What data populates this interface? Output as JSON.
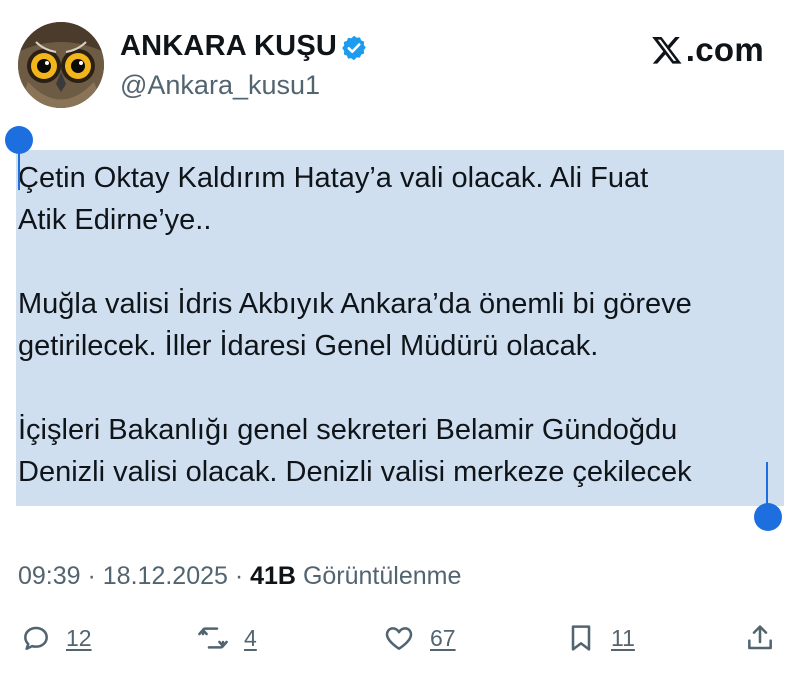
{
  "profile": {
    "display_name": "ANKARA KUŞU",
    "handle": "@Ankara_kusu1",
    "verified": true,
    "avatar_icon": "owl-avatar"
  },
  "brand": {
    "text": ".com",
    "logo_icon": "x-logo-icon"
  },
  "tweet": {
    "lines": [
      "Çetin Oktay Kaldırım Hatay’a vali olacak. Ali Fuat",
      "Atik Edirne’ye..",
      "",
      "Muğla valisi İdris Akbıyık Ankara’da önemli bi göreve",
      "getirilecek. İller İdaresi Genel Müdürü olacak.",
      "",
      "İçişleri Bakanlığı genel sekreteri Belamir Gündoğdu",
      "Denizli valisi olacak. Denizli valisi merkeze çekilecek"
    ],
    "selection_color": "#cfdff0",
    "handle_color": "#1d6fe0"
  },
  "meta": {
    "time": "09:39",
    "separator": " · ",
    "date": "18.12.2025",
    "views_count": "41B",
    "views_label": " Görüntülenme"
  },
  "actions": {
    "reply": {
      "icon": "reply-icon",
      "count": "12"
    },
    "retweet": {
      "icon": "retweet-icon",
      "count": "4"
    },
    "like": {
      "icon": "heart-icon",
      "count": "67"
    },
    "bookmark": {
      "icon": "bookmark-icon",
      "count": "11"
    },
    "share": {
      "icon": "share-icon"
    }
  }
}
